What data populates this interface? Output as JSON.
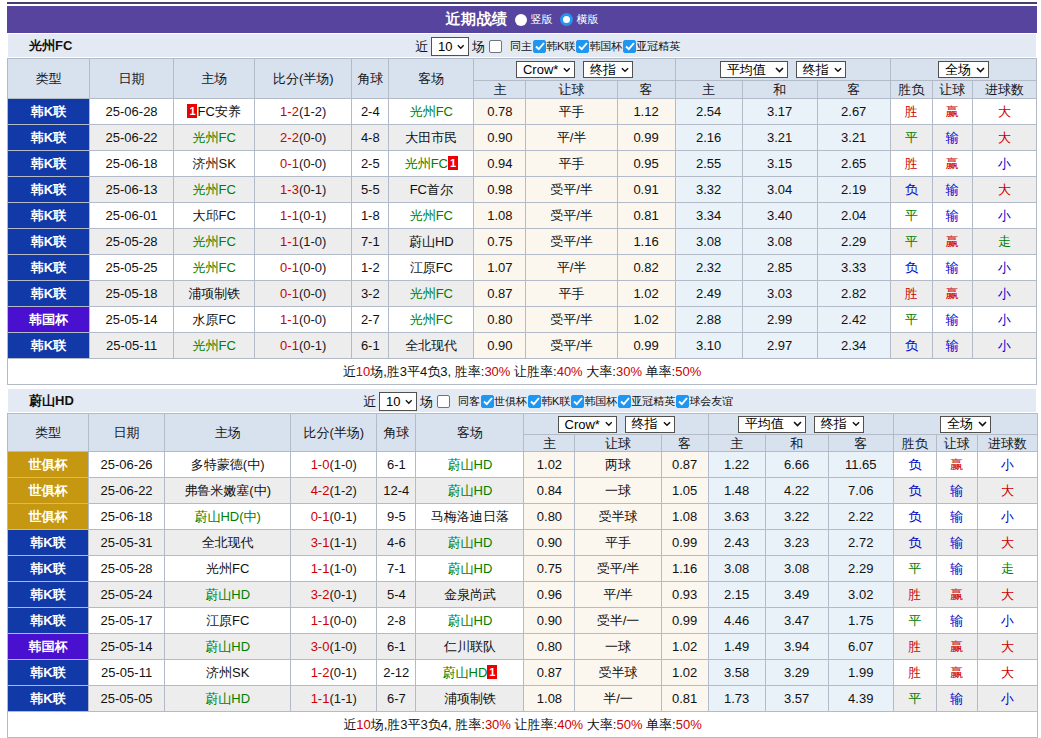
{
  "header": {
    "title": "近期战绩",
    "radios": [
      {
        "label": "竖版",
        "checked": false
      },
      {
        "label": "横版",
        "checked": true
      }
    ]
  },
  "colors": {
    "accent_purple": "#57449E",
    "league_kleague_badge": "#1139A8",
    "league_korea_cup_badge": "#4A10D0",
    "league_club_world_cup_badge": "#C69811",
    "win_red": "#CC0000",
    "draw_green": "#007E00",
    "lose_blue": "#0000CC",
    "subject_team_green": "#008000",
    "checked_blue": "#1E97F3",
    "handicap_col_bg": "#FBF6EE",
    "average_col_bg": "#E9F2F9"
  },
  "outcome_colors": {
    "胜": "red",
    "赢": "red",
    "大": "red",
    "平": "green",
    "走": "green",
    "负": "blue",
    "输": "blue",
    "小": "blue"
  },
  "tables": [
    {
      "team": "光州FC",
      "controls": {
        "near_label": "近",
        "count": "10",
        "games_label": "场",
        "checkboxes": [
          {
            "label": "同主",
            "checked": false
          },
          {
            "label": "韩K联",
            "checked": true
          },
          {
            "label": "韩国杯",
            "checked": true
          },
          {
            "label": "亚冠精英",
            "checked": true
          }
        ]
      },
      "columns": {
        "type": "类型",
        "date": "日期",
        "home": "主场",
        "score": "比分(半场)",
        "corner": "角球",
        "away": "客场"
      },
      "odds_groups": [
        {
          "selects": [
            "Crow*",
            "终指"
          ]
        },
        {
          "selects": [
            "平均值",
            "终指"
          ]
        },
        {
          "selects": [
            "全场"
          ]
        }
      ],
      "sub_columns": [
        "主",
        "让球",
        "客",
        "主",
        "和",
        "客",
        "胜负",
        "让球",
        "进球数"
      ],
      "rows": [
        {
          "league": "韩K联",
          "league_key": "kl",
          "date": "25-06-28",
          "home": "FC安养",
          "home_green": false,
          "home_card_before": "1",
          "score": "1-2",
          "half": "(1-2)",
          "corners": "2-4",
          "away": "光州FC",
          "away_green": true,
          "odds": [
            "0.78",
            "平手",
            "1.12"
          ],
          "avg": [
            "2.54",
            "3.17",
            "2.67"
          ],
          "outcome": [
            "胜",
            "赢",
            "大"
          ]
        },
        {
          "league": "韩K联",
          "league_key": "kl",
          "date": "25-06-22",
          "home": "光州FC",
          "home_green": true,
          "score": "2-2",
          "half": "(0-0)",
          "corners": "4-8",
          "away": "大田市民",
          "away_green": false,
          "odds": [
            "0.90",
            "平/半",
            "0.99"
          ],
          "avg": [
            "2.16",
            "3.21",
            "3.21"
          ],
          "outcome": [
            "平",
            "输",
            "大"
          ]
        },
        {
          "league": "韩K联",
          "league_key": "kl",
          "date": "25-06-18",
          "home": "济州SK",
          "home_green": false,
          "score": "0-1",
          "half": "(0-0)",
          "corners": "2-5",
          "away": "光州FC",
          "away_green": true,
          "away_card_after": "1",
          "odds": [
            "0.94",
            "平手",
            "0.95"
          ],
          "avg": [
            "2.55",
            "3.15",
            "2.65"
          ],
          "outcome": [
            "胜",
            "赢",
            "小"
          ]
        },
        {
          "league": "韩K联",
          "league_key": "kl",
          "date": "25-06-13",
          "home": "光州FC",
          "home_green": true,
          "score": "1-3",
          "half": "(0-1)",
          "corners": "5-5",
          "away": "FC首尔",
          "away_green": false,
          "odds": [
            "0.98",
            "受平/半",
            "0.91"
          ],
          "avg": [
            "3.32",
            "3.04",
            "2.19"
          ],
          "outcome": [
            "负",
            "输",
            "大"
          ]
        },
        {
          "league": "韩K联",
          "league_key": "kl",
          "date": "25-06-01",
          "home": "大邱FC",
          "home_green": false,
          "score": "1-1",
          "half": "(0-1)",
          "corners": "1-8",
          "away": "光州FC",
          "away_green": true,
          "odds": [
            "1.08",
            "受平/半",
            "0.81"
          ],
          "avg": [
            "3.34",
            "3.40",
            "2.04"
          ],
          "outcome": [
            "平",
            "输",
            "小"
          ]
        },
        {
          "league": "韩K联",
          "league_key": "kl",
          "date": "25-05-28",
          "home": "光州FC",
          "home_green": true,
          "score": "1-1",
          "half": "(1-0)",
          "corners": "7-1",
          "away": "蔚山HD",
          "away_green": false,
          "odds": [
            "0.75",
            "受平/半",
            "1.16"
          ],
          "avg": [
            "3.08",
            "3.08",
            "2.29"
          ],
          "outcome": [
            "平",
            "赢",
            "走"
          ]
        },
        {
          "league": "韩K联",
          "league_key": "kl",
          "date": "25-05-25",
          "home": "光州FC",
          "home_green": true,
          "score": "0-1",
          "half": "(0-0)",
          "corners": "1-2",
          "away": "江原FC",
          "away_green": false,
          "odds": [
            "1.07",
            "平/半",
            "0.82"
          ],
          "avg": [
            "2.32",
            "2.85",
            "3.33"
          ],
          "outcome": [
            "负",
            "输",
            "小"
          ]
        },
        {
          "league": "韩K联",
          "league_key": "kl",
          "date": "25-05-18",
          "home": "浦项制铁",
          "home_green": false,
          "score": "0-1",
          "half": "(0-0)",
          "corners": "3-2",
          "away": "光州FC",
          "away_green": true,
          "odds": [
            "0.87",
            "平手",
            "1.02"
          ],
          "avg": [
            "2.49",
            "3.03",
            "2.82"
          ],
          "outcome": [
            "胜",
            "赢",
            "小"
          ]
        },
        {
          "league": "韩国杯",
          "league_key": "kc",
          "date": "25-05-14",
          "home": "水原FC",
          "home_green": false,
          "score": "1-1",
          "half": "(0-0)",
          "corners": "2-7",
          "away": "光州FC",
          "away_green": true,
          "odds": [
            "0.80",
            "受平/半",
            "1.02"
          ],
          "avg": [
            "2.88",
            "2.99",
            "2.42"
          ],
          "outcome": [
            "平",
            "输",
            "小"
          ]
        },
        {
          "league": "韩K联",
          "league_key": "kl",
          "date": "25-05-11",
          "home": "光州FC",
          "home_green": true,
          "score": "0-1",
          "half": "(0-1)",
          "corners": "6-1",
          "away": "全北现代",
          "away_green": false,
          "odds": [
            "0.90",
            "受平/半",
            "0.99"
          ],
          "avg": [
            "3.10",
            "2.97",
            "2.34"
          ],
          "outcome": [
            "负",
            "输",
            "小"
          ]
        }
      ],
      "summary": [
        {
          "text": "近",
          "color": "black"
        },
        {
          "text": "10",
          "color": "red"
        },
        {
          "text": "场,胜3平4负3, 胜率:",
          "color": "black"
        },
        {
          "text": "30%",
          "color": "red"
        },
        {
          "text": " 让胜率:",
          "color": "black"
        },
        {
          "text": "40%",
          "color": "red"
        },
        {
          "text": " 大率:",
          "color": "black"
        },
        {
          "text": "30%",
          "color": "red"
        },
        {
          "text": " 单率:",
          "color": "black"
        },
        {
          "text": "50%",
          "color": "red"
        }
      ]
    },
    {
      "team": "蔚山HD",
      "controls": {
        "near_label": "近",
        "count": "10",
        "games_label": "场",
        "checkboxes": [
          {
            "label": "同客",
            "checked": false
          },
          {
            "label": "世俱杯",
            "checked": true
          },
          {
            "label": "韩K联",
            "checked": true
          },
          {
            "label": "韩国杯",
            "checked": true
          },
          {
            "label": "亚冠精英",
            "checked": true
          },
          {
            "label": "球会友谊",
            "checked": true
          }
        ]
      },
      "columns": {
        "type": "类型",
        "date": "日期",
        "home": "主场",
        "score": "比分(半场)",
        "corner": "角球",
        "away": "客场"
      },
      "odds_groups": [
        {
          "selects": [
            "Crow*",
            "终指"
          ]
        },
        {
          "selects": [
            "平均值",
            "终指"
          ]
        },
        {
          "selects": [
            "全场"
          ]
        }
      ],
      "sub_columns": [
        "主",
        "让球",
        "客",
        "主",
        "和",
        "客",
        "胜负",
        "让球",
        "进球数"
      ],
      "rows": [
        {
          "league": "世俱杯",
          "league_key": "cwc",
          "date": "25-06-26",
          "home": "多特蒙德(中)",
          "home_green": false,
          "score": "1-0",
          "half": "(1-0)",
          "corners": "6-1",
          "away": "蔚山HD",
          "away_green": true,
          "odds": [
            "1.02",
            "两球",
            "0.87"
          ],
          "avg": [
            "1.22",
            "6.66",
            "11.65"
          ],
          "outcome": [
            "负",
            "赢",
            "小"
          ]
        },
        {
          "league": "世俱杯",
          "league_key": "cwc",
          "date": "25-06-22",
          "home": "弗鲁米嫩塞(中)",
          "home_green": false,
          "score": "4-2",
          "half": "(1-2)",
          "corners": "12-4",
          "away": "蔚山HD",
          "away_green": true,
          "odds": [
            "0.84",
            "一球",
            "1.05"
          ],
          "avg": [
            "1.48",
            "4.22",
            "7.06"
          ],
          "outcome": [
            "负",
            "输",
            "大"
          ]
        },
        {
          "league": "世俱杯",
          "league_key": "cwc",
          "date": "25-06-18",
          "home": "蔚山HD(中)",
          "home_green": true,
          "score": "0-1",
          "half": "(0-1)",
          "corners": "9-5",
          "away": "马梅洛迪日落",
          "away_green": false,
          "odds": [
            "0.80",
            "受半球",
            "1.08"
          ],
          "avg": [
            "3.63",
            "3.22",
            "2.22"
          ],
          "outcome": [
            "负",
            "输",
            "小"
          ]
        },
        {
          "league": "韩K联",
          "league_key": "kl",
          "date": "25-05-31",
          "home": "全北现代",
          "home_green": false,
          "score": "3-1",
          "half": "(1-1)",
          "corners": "4-6",
          "away": "蔚山HD",
          "away_green": true,
          "odds": [
            "0.90",
            "平手",
            "0.99"
          ],
          "avg": [
            "2.43",
            "3.23",
            "2.72"
          ],
          "outcome": [
            "负",
            "输",
            "大"
          ]
        },
        {
          "league": "韩K联",
          "league_key": "kl",
          "date": "25-05-28",
          "home": "光州FC",
          "home_green": false,
          "score": "1-1",
          "half": "(1-0)",
          "corners": "7-1",
          "away": "蔚山HD",
          "away_green": true,
          "odds": [
            "0.75",
            "受平/半",
            "1.16"
          ],
          "avg": [
            "3.08",
            "3.08",
            "2.29"
          ],
          "outcome": [
            "平",
            "输",
            "走"
          ]
        },
        {
          "league": "韩K联",
          "league_key": "kl",
          "date": "25-05-24",
          "home": "蔚山HD",
          "home_green": true,
          "score": "3-2",
          "half": "(0-1)",
          "corners": "5-4",
          "away": "金泉尚武",
          "away_green": false,
          "odds": [
            "0.96",
            "平/半",
            "0.93"
          ],
          "avg": [
            "2.15",
            "3.49",
            "3.02"
          ],
          "outcome": [
            "胜",
            "赢",
            "大"
          ]
        },
        {
          "league": "韩K联",
          "league_key": "kl",
          "date": "25-05-17",
          "home": "江原FC",
          "home_green": false,
          "score": "1-1",
          "half": "(0-0)",
          "corners": "2-8",
          "away": "蔚山HD",
          "away_green": true,
          "odds": [
            "0.90",
            "受半/一",
            "0.99"
          ],
          "avg": [
            "4.46",
            "3.47",
            "1.75"
          ],
          "outcome": [
            "平",
            "输",
            "小"
          ]
        },
        {
          "league": "韩国杯",
          "league_key": "kc",
          "date": "25-05-14",
          "home": "蔚山HD",
          "home_green": true,
          "score": "3-0",
          "half": "(1-0)",
          "corners": "6-1",
          "away": "仁川联队",
          "away_green": false,
          "odds": [
            "0.80",
            "一球",
            "1.02"
          ],
          "avg": [
            "1.49",
            "3.94",
            "6.07"
          ],
          "outcome": [
            "胜",
            "赢",
            "大"
          ]
        },
        {
          "league": "韩K联",
          "league_key": "kl",
          "date": "25-05-11",
          "home": "济州SK",
          "home_green": false,
          "score": "1-2",
          "half": "(0-1)",
          "corners": "2-12",
          "away": "蔚山HD",
          "away_green": true,
          "away_card_after": "1",
          "odds": [
            "0.87",
            "受半球",
            "1.02"
          ],
          "avg": [
            "3.58",
            "3.29",
            "1.99"
          ],
          "outcome": [
            "胜",
            "赢",
            "大"
          ]
        },
        {
          "league": "韩K联",
          "league_key": "kl",
          "date": "25-05-05",
          "home": "蔚山HD",
          "home_green": true,
          "score": "1-1",
          "half": "(1-1)",
          "corners": "6-7",
          "away": "浦项制铁",
          "away_green": false,
          "odds": [
            "1.08",
            "半/一",
            "0.81"
          ],
          "avg": [
            "1.73",
            "3.57",
            "4.39"
          ],
          "outcome": [
            "平",
            "输",
            "小"
          ]
        }
      ],
      "summary": [
        {
          "text": "近",
          "color": "black"
        },
        {
          "text": "10",
          "color": "red"
        },
        {
          "text": "场,胜3平3负4, 胜率:",
          "color": "black"
        },
        {
          "text": "30%",
          "color": "red"
        },
        {
          "text": " 让胜率:",
          "color": "black"
        },
        {
          "text": "40%",
          "color": "red"
        },
        {
          "text": " 大率:",
          "color": "black"
        },
        {
          "text": "50%",
          "color": "red"
        },
        {
          "text": " 单率:",
          "color": "black"
        },
        {
          "text": "50%",
          "color": "red"
        }
      ]
    }
  ]
}
